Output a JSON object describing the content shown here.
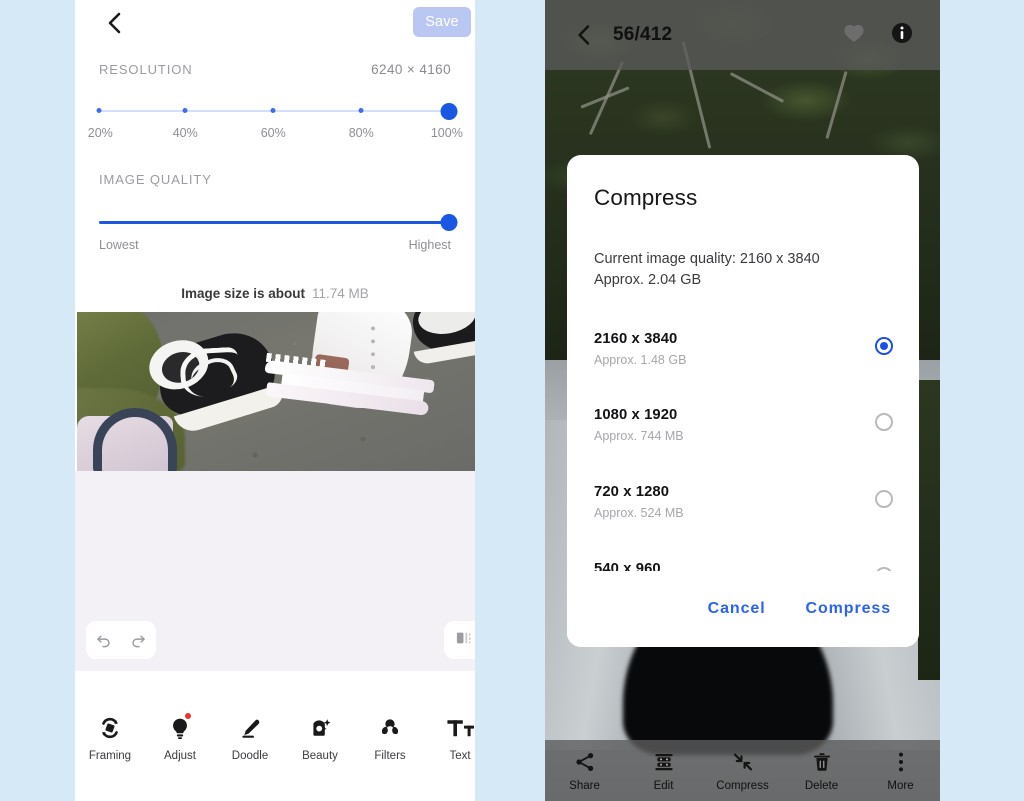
{
  "left_panel": {
    "topbar": {
      "back_icon": "chevron-left-icon",
      "save_label": "Save"
    },
    "resolution": {
      "section_label": "RESOLUTION",
      "value": "6240  ×  4160",
      "ticks": [
        "20%",
        "40%",
        "60%",
        "80%",
        "100%"
      ],
      "selected_percent": 100
    },
    "image_quality": {
      "section_label": "IMAGE QUALITY",
      "min_label": "Lowest",
      "max_label": "Highest",
      "selected_percent": 100
    },
    "size_note": {
      "label": "Image size is about",
      "value": "11.74 MB"
    },
    "canvas_controls": {
      "undo_icon": "undo-icon",
      "redo_icon": "redo-icon",
      "compare_icon": "compare-split-icon"
    },
    "toolbar": [
      {
        "label": "Framing",
        "icon": "framing-icon",
        "badge": false
      },
      {
        "label": "Adjust",
        "icon": "adjust-bulb-icon",
        "badge": true
      },
      {
        "label": "Doodle",
        "icon": "doodle-pen-icon",
        "badge": false
      },
      {
        "label": "Beauty",
        "icon": "beauty-sparkle-icon",
        "badge": false
      },
      {
        "label": "Filters",
        "icon": "filters-icon",
        "badge": false
      },
      {
        "label": "Text",
        "icon": "text-icon",
        "badge": false
      }
    ]
  },
  "right_panel": {
    "topbar": {
      "back_icon": "chevron-left-icon",
      "counter": "56/412",
      "favorite_icon": "heart-icon",
      "info_icon": "info-icon"
    },
    "dialog": {
      "title": "Compress",
      "current_line1": "Current image quality: 2160 x 3840",
      "current_line2": "Approx. 2.04 GB",
      "options": [
        {
          "title": "2160 x 3840",
          "subtitle": "Approx. 1.48 GB",
          "selected": true
        },
        {
          "title": "1080 x 1920",
          "subtitle": "Approx. 744 MB",
          "selected": false
        },
        {
          "title": "720 x 1280",
          "subtitle": "Approx. 524 MB",
          "selected": false
        },
        {
          "title": "540 x 960",
          "subtitle": "",
          "selected": false
        }
      ],
      "cancel_label": "Cancel",
      "confirm_label": "Compress"
    },
    "toolbar": [
      {
        "label": "Share",
        "icon": "share-icon"
      },
      {
        "label": "Edit",
        "icon": "edit-icon"
      },
      {
        "label": "Compress",
        "icon": "compress-arrows-icon"
      },
      {
        "label": "Delete",
        "icon": "trash-icon"
      },
      {
        "label": "More",
        "icon": "more-vertical-icon"
      }
    ]
  },
  "colors": {
    "page_background": "#d5e9f7",
    "accent_blue": "#1b57e0",
    "dialog_link_blue": "#2b62f0",
    "save_disabled": "#b9c7f2"
  }
}
